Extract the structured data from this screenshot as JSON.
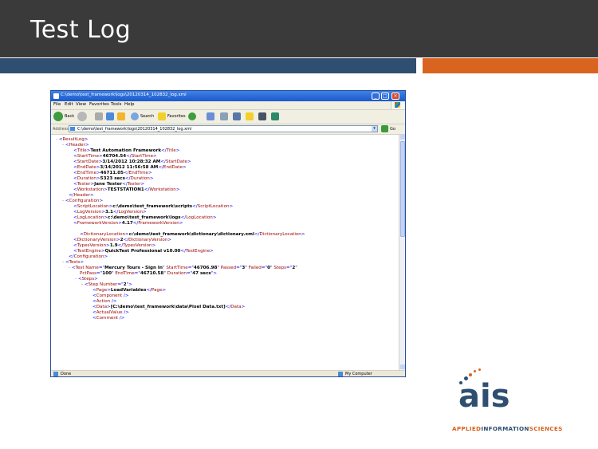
{
  "slide": {
    "title": "Test Log",
    "colors": {
      "header_bg": "#3a3a3a",
      "accent_blue": "#2e4f6f",
      "accent_orange": "#d9641f"
    }
  },
  "window": {
    "title": "C:\\demo\\test_framework\\logs\\20120314_102832_log.xml",
    "menu": [
      "File",
      "Edit",
      "View",
      "Favorites",
      "Tools",
      "Help"
    ],
    "toolbar": {
      "back": "Back",
      "search": "Search",
      "favorites": "Favorites"
    },
    "address": {
      "label": "Address",
      "value": "C:\\demo\\test_framework\\logs\\20120314_102832_log.xml",
      "go": "Go"
    },
    "status": {
      "left": "Done",
      "right": "My Computer"
    }
  },
  "xml": {
    "result_log": "ResultLog",
    "header": "Header",
    "fields": {
      "title": "Test Automation Framework",
      "start_time": "46704.54",
      "start_date": "3/14/2012 10:28:32 AM",
      "end_date": "3/14/2012 11:56:58 AM",
      "end_time": "46711.05",
      "duration": "5323 secs",
      "tester": "Jane Tester",
      "workstation": "TESTSTATION1"
    },
    "configuration": {
      "script_location": "c:\\demo\\test_framework\\scripts",
      "log_version": "3.1",
      "log_location": "c:\\demo\\test_framework\\logs",
      "framework_version": "4.17",
      "dictionary_location": "c:\\demo\\test_framework\\dictionary\\dictionary.xml",
      "dictionary_version": "2",
      "types_version": "1.9",
      "test_engine": "QuickTest Professional v10.00"
    },
    "test": {
      "name": "Mercury Tours - Sign In",
      "start_time": "46706.98",
      "passed": "3",
      "failed": "0",
      "steps": "2",
      "pct_pass": "100",
      "end_time": "46710.58",
      "duration": "47 secs"
    },
    "step": {
      "number": "2",
      "page": "LoadVariables",
      "data": "[C:\\demo\\test_framework\\data\\Pixel Data.txt]"
    }
  },
  "logo": {
    "word": "ais",
    "tagline_a": "APPLIED",
    "tagline_b": "INFORMATION",
    "tagline_c": "SCIENCES"
  }
}
